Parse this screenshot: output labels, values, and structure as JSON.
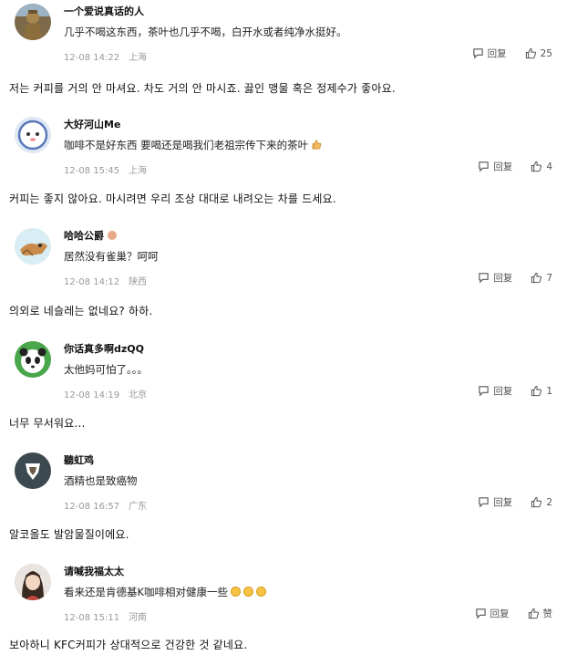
{
  "comments": [
    {
      "username": "一个爱说真话的人",
      "text": "几乎不喝这东西，茶叶也几乎不喝，白开水或者纯净水挺好。",
      "time": "12-08 14:22",
      "location": "上海",
      "reply_label": "回复",
      "likes": "25",
      "translation": "저는 커피를 거의 안 마셔요. 차도 거의 안 마시죠. 끓인 맹물 혹은 정제수가 좋아요.",
      "avatar_icon": "statue-avatar-icon"
    },
    {
      "username": "大好河山Me",
      "text": "咖啡不是好东西 要喝还是喝我们老祖宗传下来的茶叶",
      "time": "12-08 15:45",
      "location": "上海",
      "reply_label": "回复",
      "likes": "4",
      "translation": "커피는 좋지 않아요. 마시려면 우리 조상 대대로 내려오는 차를 드세요.",
      "avatar_icon": "astronaut-avatar-icon",
      "trailing_icon": "thumbs-up-emoji-icon"
    },
    {
      "username": "哈哈公爵",
      "text": "居然没有雀巢？呵呵",
      "time": "12-08 14:12",
      "location": "陕西",
      "reply_label": "回复",
      "likes": "7",
      "translation": "의외로 네슬레는 없네요? 하하.",
      "avatar_icon": "cartoon-avatar-icon",
      "badge_icon": "user-badge-icon"
    },
    {
      "username": "你话真多啊dzQQ",
      "text": "太他妈可怕了。。。",
      "time": "12-08 14:19",
      "location": "北京",
      "reply_label": "回复",
      "likes": "1",
      "translation": "너무 무서워요...",
      "avatar_icon": "panda-avatar-icon"
    },
    {
      "username": "聽虹鸡",
      "text": "酒精也是致癌物",
      "time": "12-08 16:57",
      "location": "广东",
      "reply_label": "回复",
      "likes": "2",
      "translation": "알코올도 발암물질이에요.",
      "avatar_icon": "dark-avatar-icon"
    },
    {
      "username": "请喊我福太太",
      "text": "看来还是肯德基K咖啡相对健康一些",
      "time": "12-08 15:11",
      "location": "河南",
      "reply_label": "回复",
      "likes": "赞",
      "translation": "보아하니 KFC커피가 상대적으로 건강한 것 같네요.",
      "avatar_icon": "girl-avatar-icon",
      "trailing_icon": "laughing-emoji-icon"
    }
  ],
  "colors": {
    "meta": "#999999",
    "text": "#222222"
  }
}
